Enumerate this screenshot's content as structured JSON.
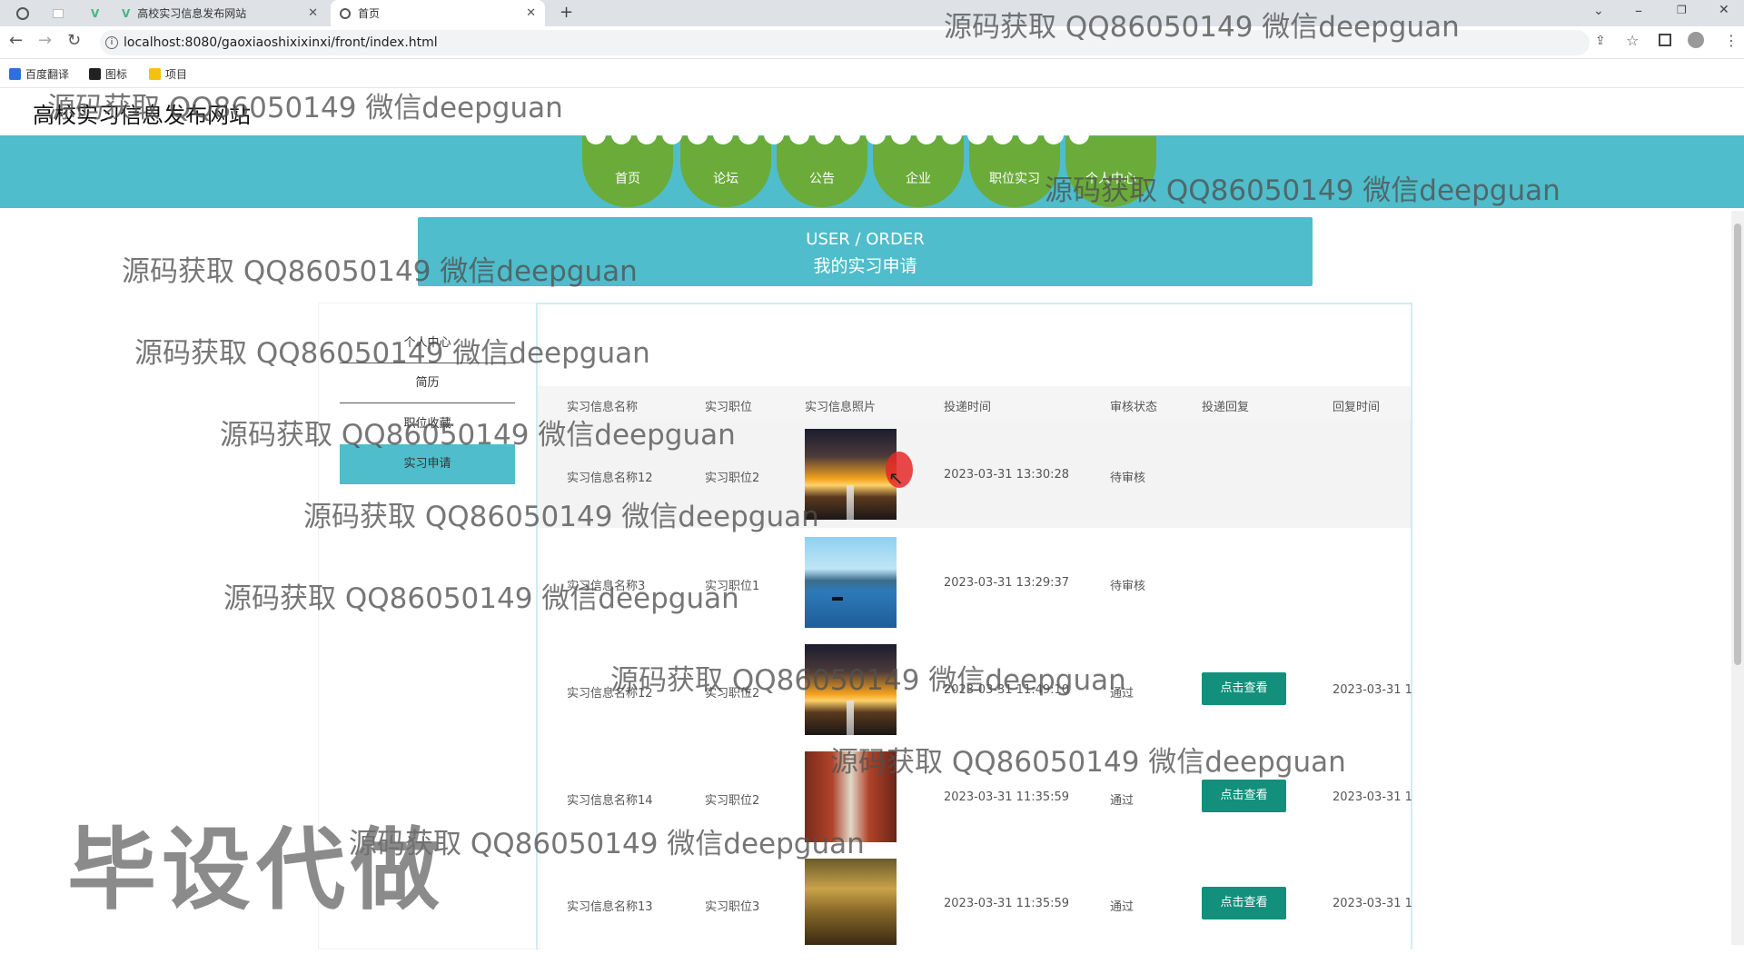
{
  "browser": {
    "tabs": [
      {
        "title": ""
      },
      {
        "title": "高校实习信息发布网站"
      },
      {
        "title": "首页"
      }
    ],
    "url": "localhost:8080/gaoxiaoshixixinxi/front/index.html",
    "bookmarks": [
      "百度翻译",
      "图标",
      "项目"
    ]
  },
  "site": {
    "title": "高校实习信息发布网站",
    "nav": [
      "首页",
      "论坛",
      "公告",
      "企业",
      "职位实习",
      "个人中心"
    ]
  },
  "banner": {
    "en": "USER / ORDER",
    "zh": "我的实习申请"
  },
  "sidebar": {
    "items": [
      "个人中心",
      "简历",
      "职位收藏",
      "实习申请"
    ],
    "active": "实习申请"
  },
  "table": {
    "headers": [
      "实习信息名称",
      "实习职位",
      "实习信息照片",
      "投递时间",
      "审核状态",
      "投递回复",
      "回复时间"
    ],
    "rows": [
      {
        "name": "实习信息名称12",
        "position": "实习职位2",
        "photo": "sunset-road-photo",
        "time": "2023-03-31 13:30:28",
        "status": "待审核",
        "reply": "",
        "reply_time": ""
      },
      {
        "name": "实习信息名称3",
        "position": "实习职位1",
        "photo": "lake-photo",
        "time": "2023-03-31 13:29:37",
        "status": "待审核",
        "reply": "",
        "reply_time": ""
      },
      {
        "name": "实习信息名称12",
        "position": "实习职位2",
        "photo": "sunset-road-photo",
        "time": "2023-03-31 11:49:10",
        "status": "通过",
        "reply": "点击查看",
        "reply_time": "2023-03-31 1"
      },
      {
        "name": "实习信息名称14",
        "position": "实习职位2",
        "photo": "corridor-photo",
        "time": "2023-03-31 11:35:59",
        "status": "通过",
        "reply": "点击查看",
        "reply_time": "2023-03-31 1"
      },
      {
        "name": "实习信息名称13",
        "position": "实习职位3",
        "photo": "mountain-photo",
        "time": "2023-03-31 11:35:59",
        "status": "通过",
        "reply": "点击查看",
        "reply_time": "2023-03-31 1"
      }
    ]
  },
  "watermarks": {
    "text": "源码获取 QQ86050149 微信deepguan",
    "big": "毕设代做"
  },
  "colors": {
    "teal": "#4fbdcb",
    "nav_green": "#6aab3a",
    "button": "#12907c"
  }
}
